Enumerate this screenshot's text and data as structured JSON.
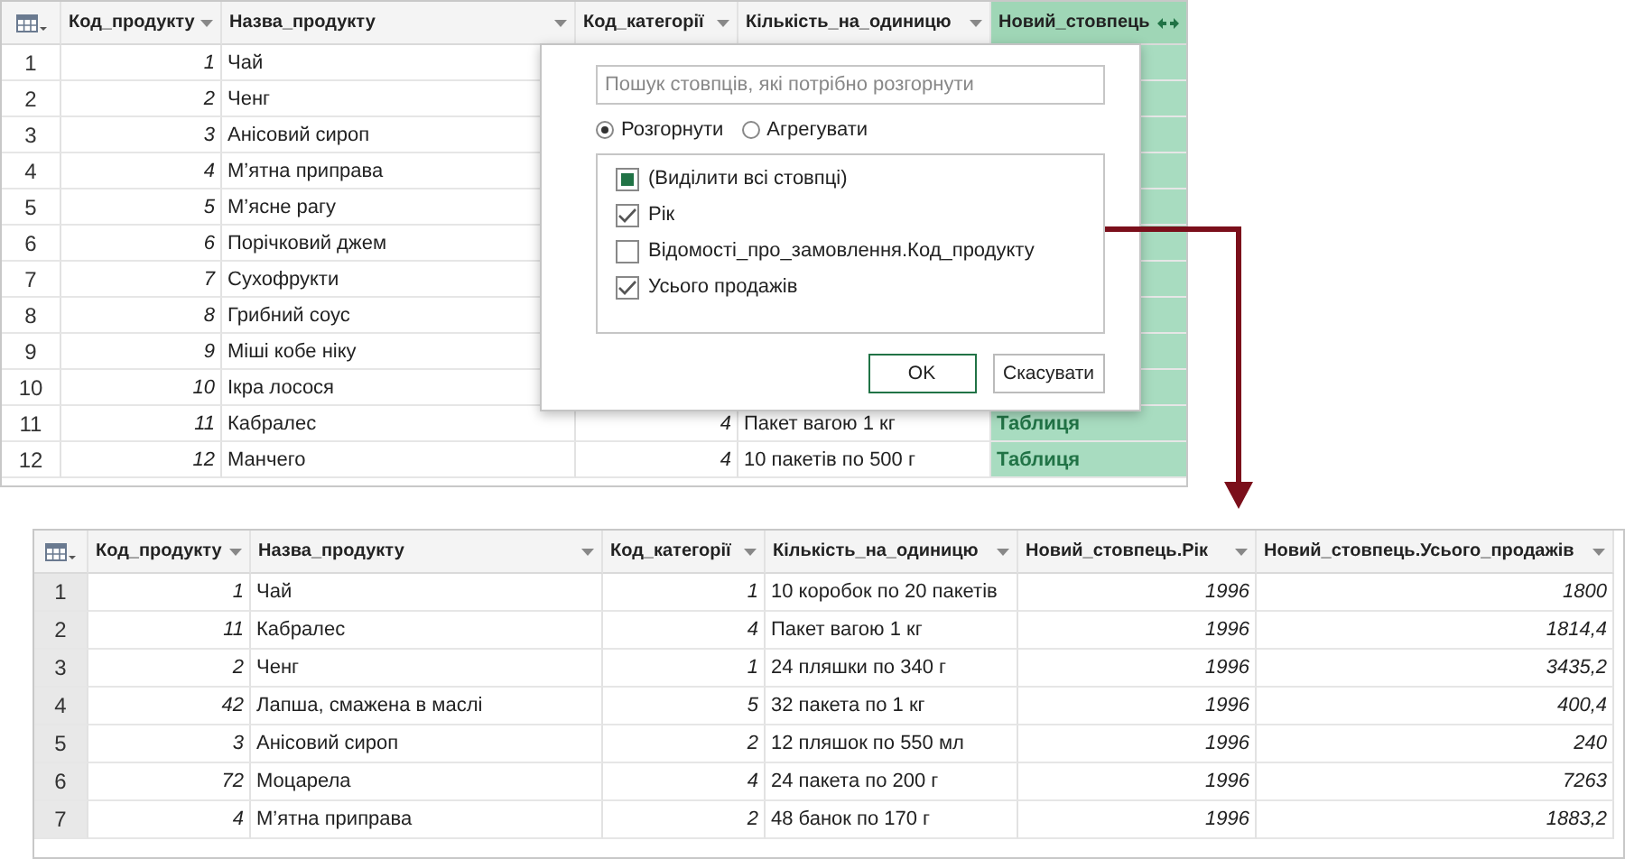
{
  "top_table": {
    "columns": [
      {
        "label": "Код_продукту",
        "kind": "number"
      },
      {
        "label": "Назва_продукту",
        "kind": "text"
      },
      {
        "label": "Код_категорії",
        "kind": "number"
      },
      {
        "label": "Кількість_на_одиницю",
        "kind": "text"
      },
      {
        "label": "Новий_стовпець",
        "kind": "table"
      }
    ],
    "rows": [
      {
        "number": "1",
        "cells": [
          "1",
          "Чай"
        ]
      },
      {
        "number": "2",
        "cells": [
          "2",
          "Ченг"
        ]
      },
      {
        "number": "3",
        "cells": [
          "3",
          "Анісовий сироп"
        ]
      },
      {
        "number": "4",
        "cells": [
          "4",
          "М’ятна приправа"
        ]
      },
      {
        "number": "5",
        "cells": [
          "5",
          "М’ясне рагу"
        ]
      },
      {
        "number": "6",
        "cells": [
          "6",
          "Порічковий джем"
        ]
      },
      {
        "number": "7",
        "cells": [
          "7",
          "Сухофрукти"
        ]
      },
      {
        "number": "8",
        "cells": [
          "8",
          "Грибний соус"
        ]
      },
      {
        "number": "9",
        "cells": [
          "9",
          "Міші кобе ніку"
        ]
      },
      {
        "number": "10",
        "cells": [
          "10",
          "Ікра лосося"
        ]
      },
      {
        "number": "11",
        "cells": [
          "11",
          "Кабралес",
          "4",
          "Пакет вагою 1 кг",
          "Таблиця"
        ]
      },
      {
        "number": "12",
        "cells": [
          "12",
          "Манчего",
          "4",
          "10 пакетів по 500 г",
          "Таблиця"
        ]
      }
    ]
  },
  "expand_dialog": {
    "search": {
      "placeholder": "Пошук стовпців, які потрібно розгорнути"
    },
    "modes": [
      {
        "label": "Розгорнути",
        "selected": true
      },
      {
        "label": "Агрегувати",
        "selected": false
      }
    ],
    "columns": [
      {
        "label": "(Виділити всі стовпці)",
        "checked": false,
        "partial": true
      },
      {
        "label": "Рік",
        "checked": true,
        "partial": false
      },
      {
        "label": "Відомості_про_замовлення.Код_продукту",
        "checked": false,
        "partial": false
      },
      {
        "label": "Усього продажів",
        "checked": true,
        "partial": false
      }
    ],
    "buttons": [
      {
        "label": "OK",
        "primary": true
      },
      {
        "label": "Скасувати",
        "primary": false
      }
    ]
  },
  "bottom_table": {
    "columns": [
      {
        "label": "Код_продукту",
        "kind": "number"
      },
      {
        "label": "Назва_продукту",
        "kind": "text"
      },
      {
        "label": "Код_категорії",
        "kind": "number"
      },
      {
        "label": "Кількість_на_одиницю",
        "kind": "text"
      },
      {
        "label": "Новий_стовпець.Рік",
        "kind": "number"
      },
      {
        "label": "Новий_стовпець.Усього_продажів",
        "kind": "number"
      }
    ],
    "rows": [
      {
        "number": "1",
        "cells": [
          "1",
          "Чай",
          "1",
          "10 коробок по 20 пакетів",
          "1996",
          "1800"
        ]
      },
      {
        "number": "2",
        "cells": [
          "11",
          "Кабралес",
          "4",
          "Пакет вагою 1 кг",
          "1996",
          "1814,4"
        ]
      },
      {
        "number": "3",
        "cells": [
          "2",
          "Ченг",
          "1",
          "24 пляшки по 340 г",
          "1996",
          "3435,2"
        ]
      },
      {
        "number": "4",
        "cells": [
          "42",
          "Лапша, смажена в маслі",
          "5",
          "32 пакета по 1 кг",
          "1996",
          "400,4"
        ]
      },
      {
        "number": "5",
        "cells": [
          "3",
          "Анісовий сироп",
          "2",
          "12 пляшок по 550 мл",
          "1996",
          "240"
        ]
      },
      {
        "number": "6",
        "cells": [
          "72",
          "Моцарела",
          "4",
          "24 пакета по 200 г",
          "1996",
          "7263"
        ]
      },
      {
        "number": "7",
        "cells": [
          "4",
          "М’ятна приправа",
          "2",
          "48 банок по 170 г",
          "1996",
          "1883,2"
        ]
      }
    ]
  }
}
